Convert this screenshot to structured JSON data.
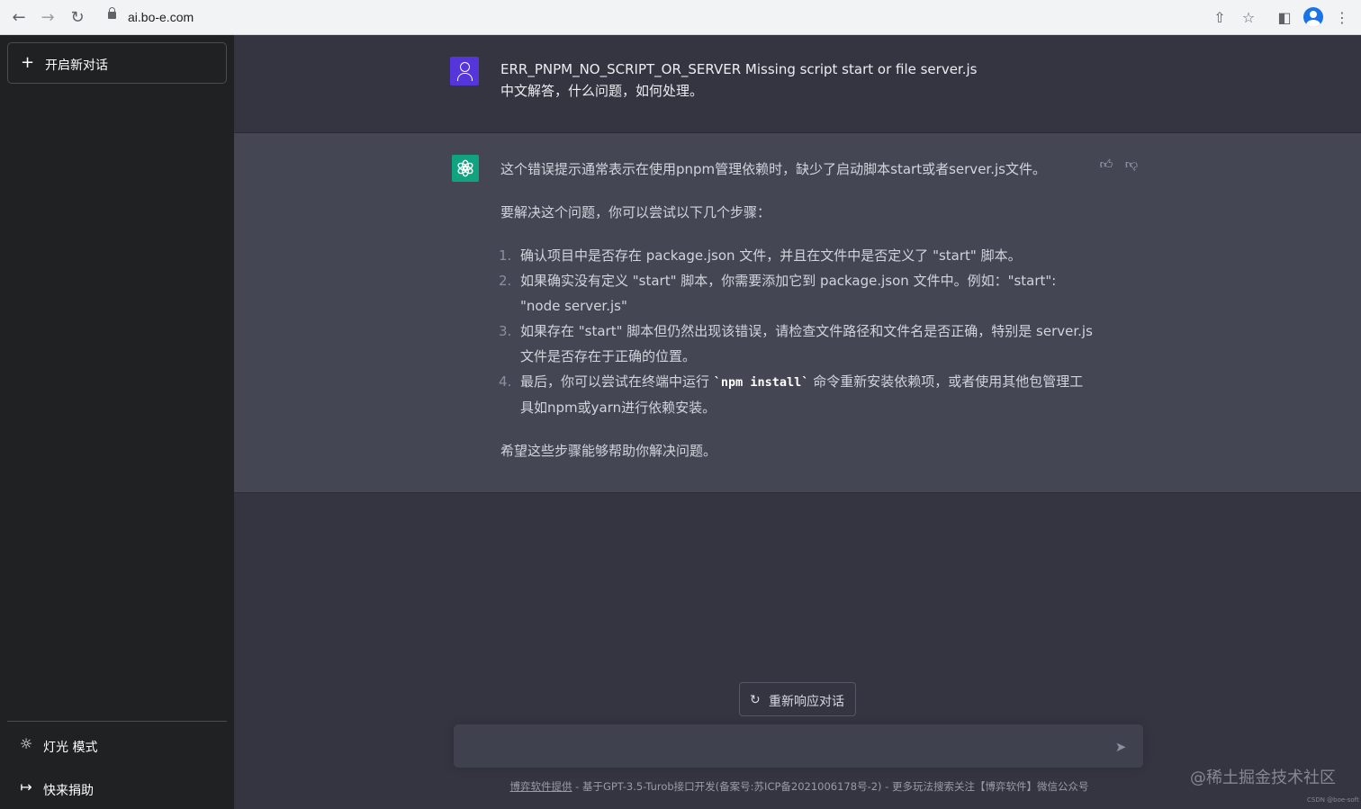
{
  "browser": {
    "url": "ai.bo-e.com",
    "back_icon": "back-arrow-icon",
    "forward_icon": "forward-arrow-icon",
    "reload_icon": "reload-icon"
  },
  "sidebar": {
    "new_chat_label": "开启新对话",
    "items": [
      {
        "icon": "sun-icon",
        "label": "灯光 模式"
      },
      {
        "icon": "logout-icon",
        "label": "快来捐助"
      }
    ]
  },
  "conversation": {
    "user_message_line1": "ERR_PNPM_NO_SCRIPT_OR_SERVER Missing script start or file server.js",
    "user_message_line2": "中文解答，什么问题，如何处理。",
    "bot_intro": "这个错误提示通常表示在使用pnpm管理依赖时，缺少了启动脚本start或者server.js文件。",
    "bot_steps_intro": "要解决这个问题，你可以尝试以下几个步骤：",
    "steps": [
      {
        "num": "1.",
        "text": "确认项目中是否存在 package.json 文件，并且在文件中是否定义了 \"start\" 脚本。"
      },
      {
        "num": "2.",
        "text": "如果确实没有定义 \"start\" 脚本，你需要添加它到 package.json 文件中。例如：\"start\": \"node server.js\""
      },
      {
        "num": "3.",
        "text": "如果存在 \"start\" 脚本但仍然出现该错误，请检查文件路径和文件名是否正确，特别是 server.js 文件是否存在于正确的位置。"
      },
      {
        "num": "4.",
        "text_before": "最后，你可以尝试在终端中运行 ",
        "code": "`npm install`",
        "text_after": " 命令重新安装依赖项，或者使用其他包管理工具如npm或yarn进行依赖安装。"
      }
    ],
    "bot_outro": "希望这些步骤能够帮助你解决问题。"
  },
  "regenerate_label": "重新响应对话",
  "input": {
    "placeholder": "",
    "value": ""
  },
  "footer": {
    "link_text": "博弈软件提供",
    "text": " - 基于GPT-3.5-Turob接口开发(备案号:苏ICP备2021006178号-2) - 更多玩法搜索关注【博弈软件】微信公众号"
  },
  "watermark": "@稀土掘金技术社区",
  "watermark_small": "CSDN @boe-soft"
}
